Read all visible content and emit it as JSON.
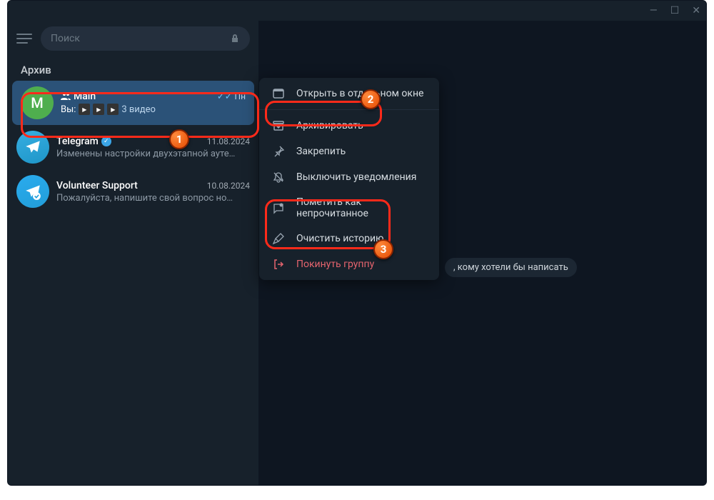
{
  "titlebar": {
    "min": "—",
    "max": "☐",
    "close": "✕"
  },
  "sidebar": {
    "search_placeholder": "Поиск",
    "archive_label": "Архив",
    "chats": [
      {
        "name": "Main",
        "avatar_letter": "M",
        "time": "Пн",
        "you_prefix": "Вы:",
        "preview_suffix": "3 видео",
        "selected": true
      },
      {
        "name": "Telegram",
        "time": "11.08.2024",
        "preview": "Изменены настройки двухэтапной ауте…"
      },
      {
        "name": "Volunteer Support",
        "time": "10.08.2024",
        "preview": "Пожалуйста, напишите свой вопрос но…"
      }
    ]
  },
  "context_menu": {
    "open_window": "Открыть в отдельном окне",
    "archive": "Архивировать",
    "pin": "Закрепить",
    "mute": "Выключить уведомления",
    "mark_unread": "Пометить как непрочитанное",
    "clear_history": "Очистить историю",
    "leave_group": "Покинуть группу"
  },
  "main_hint": ", кому хотели бы написать",
  "badges": {
    "b1": "1",
    "b2": "2",
    "b3": "3"
  }
}
